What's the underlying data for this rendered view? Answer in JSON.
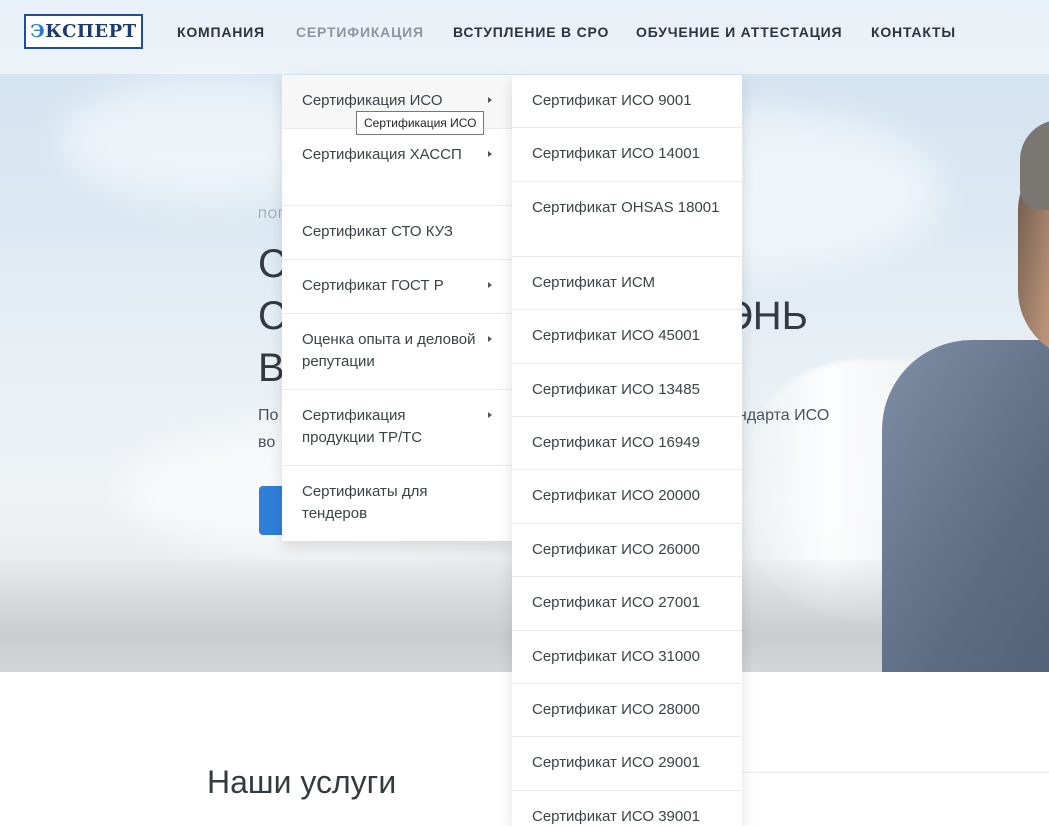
{
  "logo": {
    "first_letter": "Э",
    "rest": "КСПЕРТ"
  },
  "nav": [
    {
      "label": "КОМПАНИЯ",
      "active": false
    },
    {
      "label": "СЕРТИФИКАЦИЯ",
      "active": true
    },
    {
      "label": "ВСТУПЛЕНИЕ В СРО",
      "active": false
    },
    {
      "label": "ОБУЧЕНИЕ И АТТЕСТАЦИЯ",
      "active": false
    },
    {
      "label": "КОНТАКТЫ",
      "active": false
    }
  ],
  "hero": {
    "crumb": "ПОГ",
    "title_lines": [
      "С",
      "С",
      "В"
    ],
    "title_partial": "ЭНЬ",
    "text_line1": "По",
    "text_line1_end": "ндарта ИСО",
    "text_line2": "во"
  },
  "submenu": [
    {
      "label": "Сертификация ИСО",
      "has_children": true
    },
    {
      "label": "Сертификация ХАССП",
      "has_children": true
    },
    {
      "label": "Сертификат СТО КУЗ",
      "has_children": false
    },
    {
      "label": "Сертификат ГОСТ Р",
      "has_children": true
    },
    {
      "label": "Оценка опыта и деловой репутации",
      "has_children": true
    },
    {
      "label": "Сертификация продукции ТР/ТС",
      "has_children": true
    },
    {
      "label": "Сертификаты для тендеров",
      "has_children": false
    }
  ],
  "iso_submenu": [
    "Сертификат ИСО 9001",
    "Сертификат ИСО 14001",
    "Сертификат OHSAS 18001",
    "Сертификат ИСМ",
    "Сертификат ИСО 45001",
    "Сертификат ИСО 13485",
    "Сертификат ИСО 16949",
    "Сертификат ИСО 20000",
    "Сертификат ИСО 26000",
    "Сертификат ИСО 27001",
    "Сертификат ИСО 31000",
    "Сертификат ИСО 28000",
    "Сертификат ИСО 29001",
    "Сертификат ИСО 39001"
  ],
  "tooltip": "Сертификация ИСО",
  "services": {
    "title": "Наши услуги"
  },
  "colors": {
    "accent": "#2f7fd8",
    "logo_border": "#1f4e9e",
    "nav_active": "#8f979e"
  }
}
